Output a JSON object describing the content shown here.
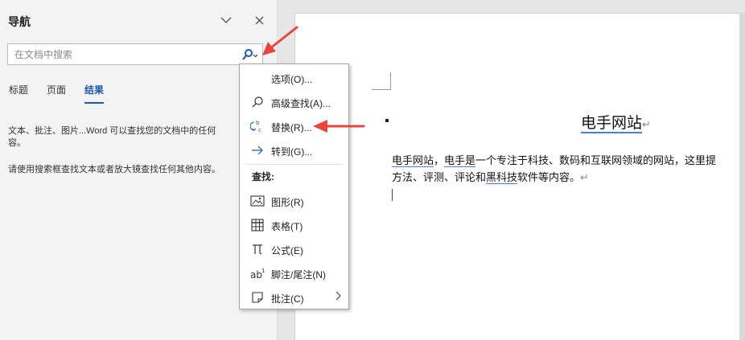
{
  "nav": {
    "title": "导航",
    "search_placeholder": "在文档中搜索",
    "tabs": [
      "标题",
      "页面",
      "结果"
    ],
    "active_tab": "结果",
    "info_line1": "文本、批注、图片...Word 可以查找您的文档中的任何",
    "info_line2": "容。",
    "info_line3": "请使用搜索框查找文本或者放大镜查找任何其他内容。"
  },
  "menu": {
    "options": "选项(O)...",
    "advanced_find": "高级查找(A)...",
    "replace": "替换(R)...",
    "goto": "转到(G)...",
    "find_heading": "查找:",
    "graphics": "图形(R)",
    "tables": "表格(T)",
    "equations": "公式(E)",
    "footnotes": "脚注/尾注(N)",
    "comments": "批注(C)"
  },
  "doc": {
    "title": "电手网站",
    "para_line1_a": "电手网站",
    "para_line1_b": "，",
    "para_line1_c": "电手是",
    "para_line1_d": "一个专注于科技、数码和互联网领域的网站，这里提",
    "para_line2_a": "方法、评测、评论和",
    "para_line2_b": "黑科技",
    "para_line2_c": "软件等内容。",
    "return_mark": "↵"
  },
  "colors": {
    "accent": "#1e5aa8",
    "annotation_arrow": "#e8453c",
    "link_underline": "#4d7fd1"
  }
}
